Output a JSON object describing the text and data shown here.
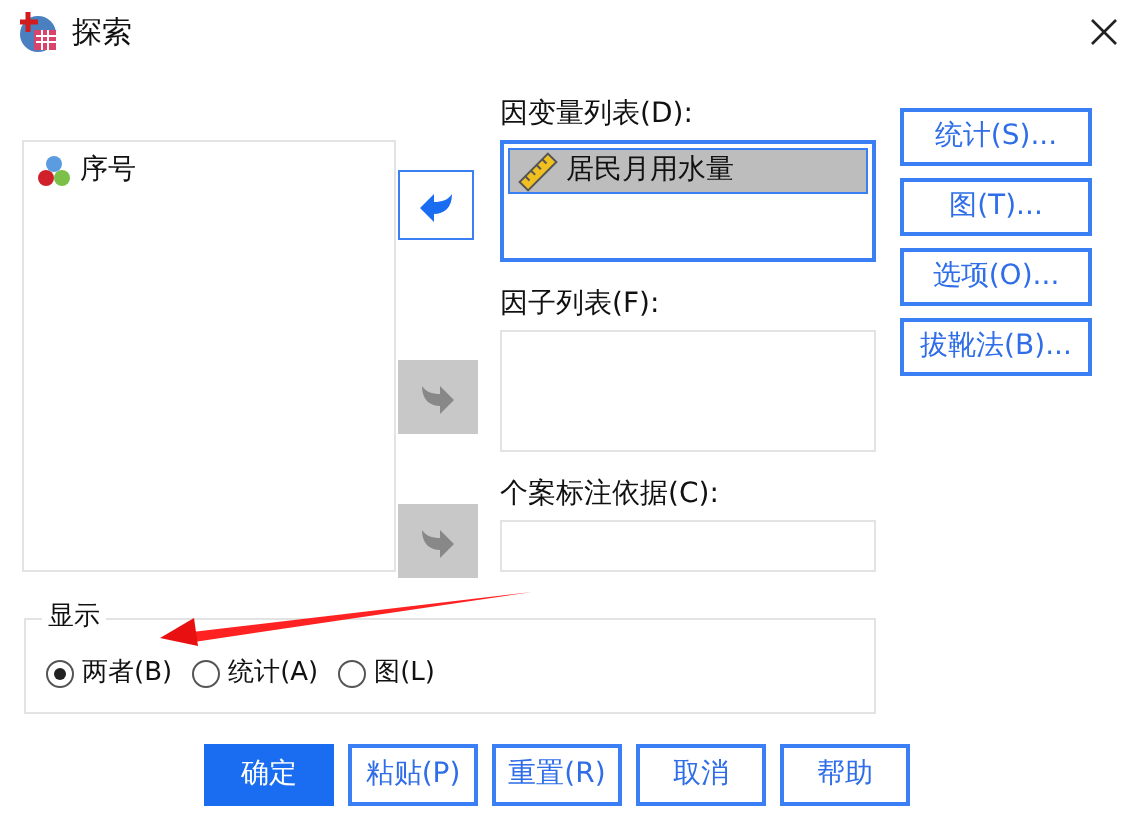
{
  "window": {
    "title": "探索"
  },
  "source_list": {
    "items": [
      {
        "label": "序号",
        "kind": "nominal"
      }
    ]
  },
  "move_buttons": [
    {
      "disabled": false
    },
    {
      "disabled": true
    },
    {
      "disabled": true
    }
  ],
  "dependent_list": {
    "label": "因变量列表(D):",
    "items": [
      {
        "label": "居民月用水量",
        "kind": "scale",
        "selected": true
      }
    ]
  },
  "factor_list": {
    "label": "因子列表(F):"
  },
  "label_cases_by": {
    "label": "个案标注依据(C):"
  },
  "side_buttons": [
    "统计(S)...",
    "图(T)...",
    "选项(O)...",
    "拔靴法(B)..."
  ],
  "display": {
    "label": "显示",
    "options": [
      {
        "label": "两者(B)",
        "selected": true
      },
      {
        "label": "统计(A)",
        "selected": false
      },
      {
        "label": "图(L)",
        "selected": false
      }
    ]
  },
  "buttons": [
    {
      "label": "确定",
      "primary": true
    },
    {
      "label": "粘贴(P)",
      "primary": false
    },
    {
      "label": "重置(R)",
      "primary": false
    },
    {
      "label": "取消",
      "primary": false
    },
    {
      "label": "帮助",
      "primary": false
    }
  ]
}
